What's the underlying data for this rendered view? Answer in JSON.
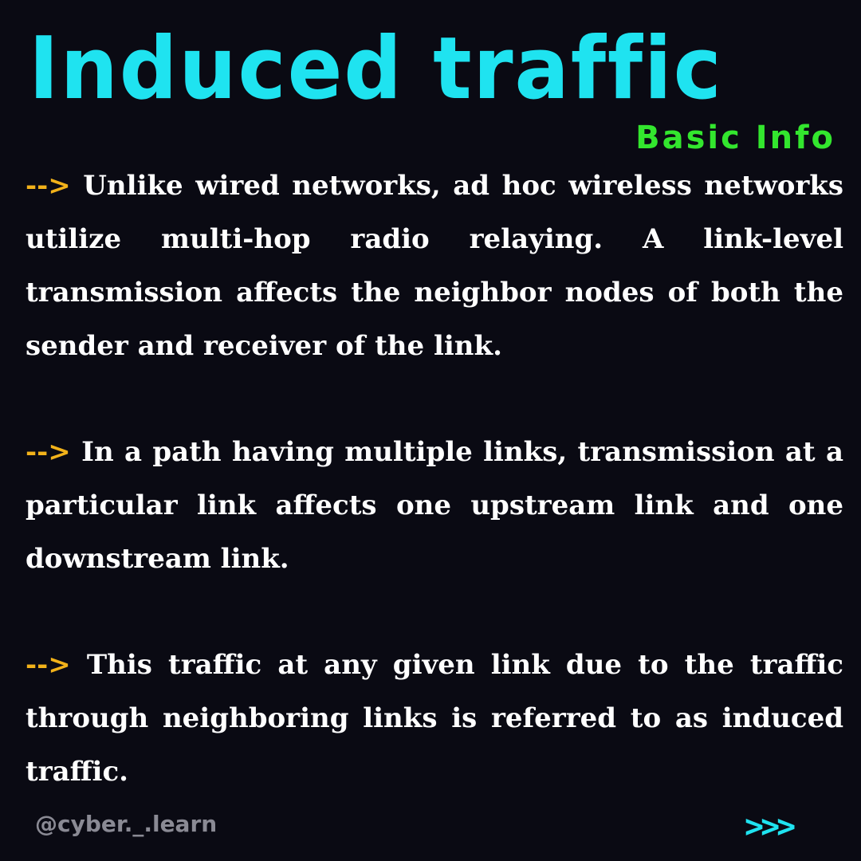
{
  "header": {
    "title": "Induced traffic",
    "subtitle": "Basic Info"
  },
  "colors": {
    "background": "#0a0a13",
    "title": "#1fe3f0",
    "subtitle": "#33e62e",
    "arrow": "#f2b21a",
    "body_text": "#ffffff",
    "handle": "#8a8a94"
  },
  "paragraphs": [
    {
      "bullet": "-->",
      "text": "Unlike wired networks, ad hoc wireless networks utilize multi-hop radio relaying. A link-level transmission affects the neighbor nodes of both the sender and receiver of the link."
    },
    {
      "bullet": "-->",
      "text": "In a path having multiple links, transmission at a particular link affects one upstream link and one downstream link."
    },
    {
      "bullet": "-->",
      "text": "This traffic at any given link due to the traffic through neighboring links is referred to as induced traffic."
    }
  ],
  "footer": {
    "handle": "@cyber._.learn",
    "next_label": ">>>"
  }
}
